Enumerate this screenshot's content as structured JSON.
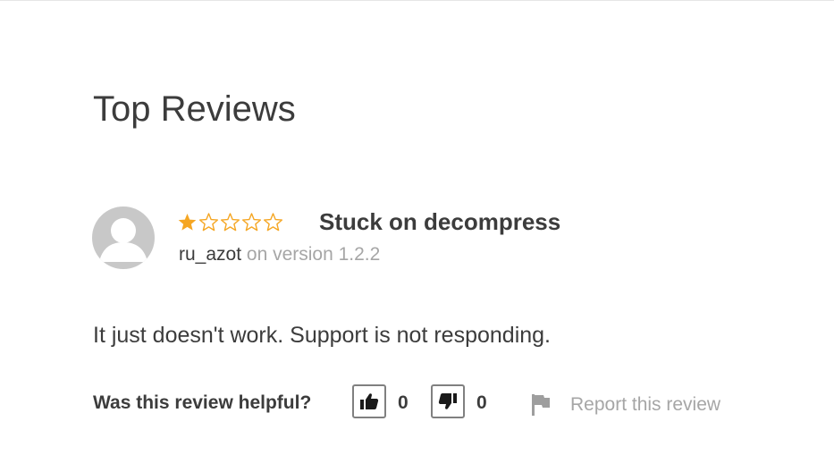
{
  "section": {
    "title": "Top Reviews"
  },
  "review": {
    "rating": 1,
    "rating_max": 5,
    "star_color": "#f5a623",
    "title": "Stuck on decompress",
    "author": "ru_azot",
    "version_text": "on version 1.2.2",
    "body": "It just doesn't work. Support is not responding."
  },
  "feedback": {
    "question": "Was this review helpful?",
    "helpful_count": "0",
    "not_helpful_count": "0",
    "thumbs_up_icon": "thumbs-up-icon",
    "thumbs_down_icon": "thumbs-down-icon",
    "report_icon": "flag-icon",
    "report_label": "Report this review"
  }
}
